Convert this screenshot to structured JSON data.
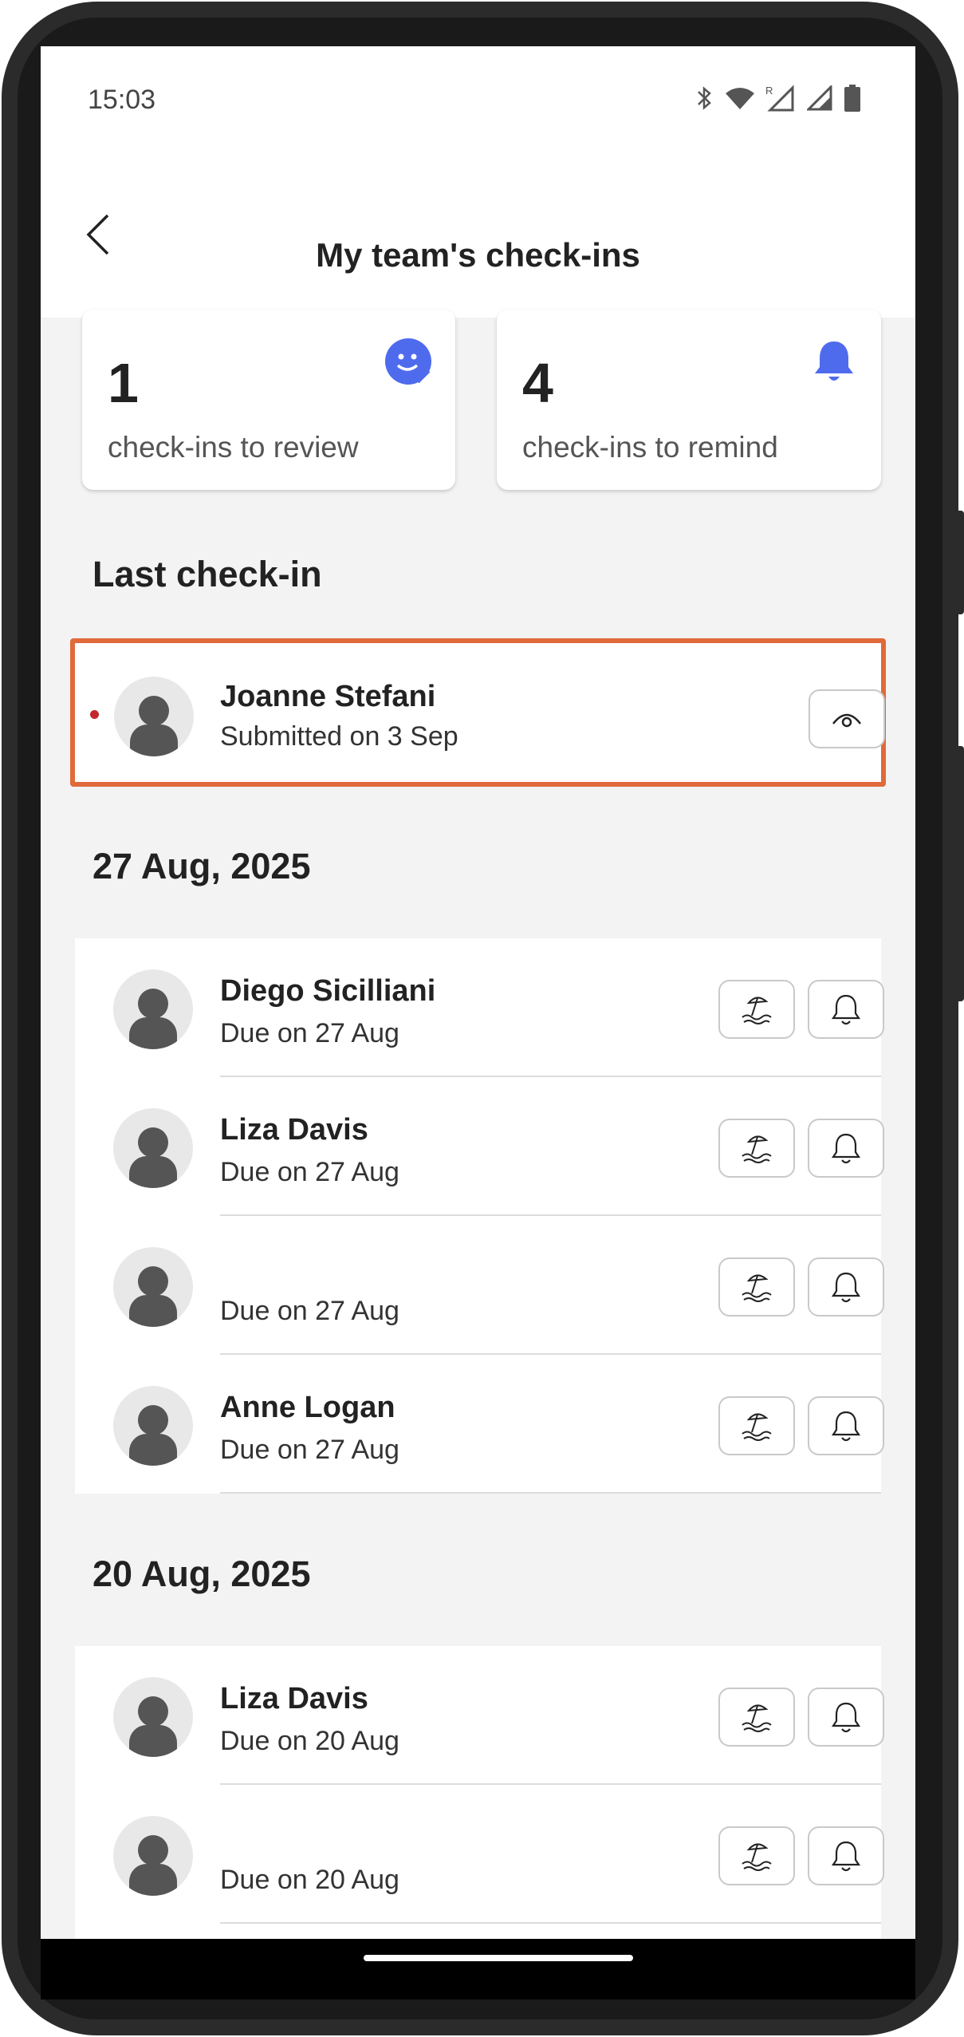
{
  "status_bar": {
    "time": "15:03"
  },
  "header": {
    "title": "My team's check-ins"
  },
  "stats": [
    {
      "count": "1",
      "label": "check-ins to review",
      "icon": "review-sticker-icon"
    },
    {
      "count": "4",
      "label": "check-ins to remind",
      "icon": "bell-icon"
    }
  ],
  "colors": {
    "accent": "#4f6bed",
    "highlight_border": "#e06a3a",
    "unread_dot": "#c4262e"
  },
  "last_checkin": {
    "title": "Last check-in",
    "name": "Joanne Stefani",
    "subtitle": "Submitted on 3 Sep",
    "action_icon": "eye-icon"
  },
  "groups": [
    {
      "date": "27 Aug, 2025",
      "rows": [
        {
          "name": "Diego Sicilliani",
          "subtitle": "Due on 27 Aug"
        },
        {
          "name": "Liza Davis",
          "subtitle": "Due on 27 Aug"
        },
        {
          "name": "",
          "subtitle": "Due on 27 Aug"
        },
        {
          "name": "Anne Logan",
          "subtitle": "Due on 27 Aug"
        }
      ]
    },
    {
      "date": "20 Aug, 2025",
      "rows": [
        {
          "name": "Liza Davis",
          "subtitle": "Due on 20 Aug"
        },
        {
          "name": "",
          "subtitle": "Due on 20 Aug"
        }
      ]
    }
  ]
}
